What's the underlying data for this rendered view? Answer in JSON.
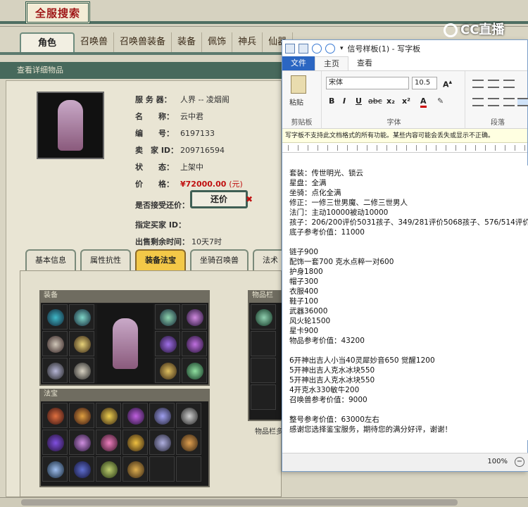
{
  "game": {
    "title": "全服搜索",
    "tabs": [
      "角色",
      "召唤兽",
      "召唤兽装备",
      "装备",
      "佩饰",
      "神兵",
      "仙器"
    ],
    "detail_header": "查看详细物品",
    "info": [
      {
        "k": "服 务 器：",
        "v": "人界 -- 凌烟阁"
      },
      {
        "k": "名　　称：",
        "v": "云中君"
      },
      {
        "k": "编　　号：",
        "v": "6197133"
      },
      {
        "k": "卖　家 ID：",
        "v": "209716594"
      },
      {
        "k": "状　　态：",
        "v": "上架中"
      },
      {
        "k": "价　　格：",
        "v": "¥72000.00",
        "unit": "(元)"
      },
      {
        "k": "是否接受还价：",
        "v": ""
      },
      {
        "k": "指定买家 ID：",
        "v": ""
      },
      {
        "k": "出售剩余时间：",
        "v": "10天7时"
      }
    ],
    "bargain_label": "还价",
    "bargain_close": "✖",
    "subtabs": [
      "基本信息",
      "属性抗性",
      "装备法宝",
      "坐骑召唤兽",
      "法术"
    ],
    "equip_title": "装备",
    "fabao_title": "法宝",
    "item_bar_title": "物品栏",
    "item_caption": "物品栏多",
    "logo": "CC直播"
  },
  "wordpad": {
    "title": "信号样板(1) - 写字板",
    "tabs": {
      "file": "文件",
      "home": "主页",
      "view": "查看"
    },
    "font_name": "宋体",
    "font_size": "10.5",
    "groups": {
      "clipboard": "剪贴板",
      "font": "字体",
      "paragraph": "段落"
    },
    "paste_label": "粘贴",
    "font_buttons": [
      "B",
      "I",
      "U",
      "abc",
      "x₂",
      "x²",
      "A"
    ],
    "notice": "写字板不支持此文档格式的所有功能。某些内容可能会丢失或显示不正确。",
    "lines": [
      "套装：传世明光、锁云",
      "星盘：全满",
      "坐骑：点化全满",
      "修正：一修三世男魔、二修三世男人",
      "法门：主动10000被动10000",
      "孩子：206/200评价5031孩子、349/281评价5068孩子、576/514评价5076",
      "底子参考价值：11000",
      "",
      "链子900",
      "配饰一套700 克水点粹一对600",
      "护身1800",
      "帽子300",
      "衣服400",
      "鞋子100",
      "武器36000",
      "风火轮1500",
      "星卡900",
      "物品参考价值：43200",
      "",
      "6开神出吉人小当40灵犀妙音650 觉醒1200",
      "5开神出吉人克水冰块550",
      "5开神出吉人克水冰块550",
      "4开克水330敏牛200",
      "召唤兽参考价值：9000",
      "",
      "整号参考价值：63000左右",
      "感谢您选择鉴宝服务，期待您的满分好评，谢谢！"
    ],
    "zoom": "100%"
  }
}
